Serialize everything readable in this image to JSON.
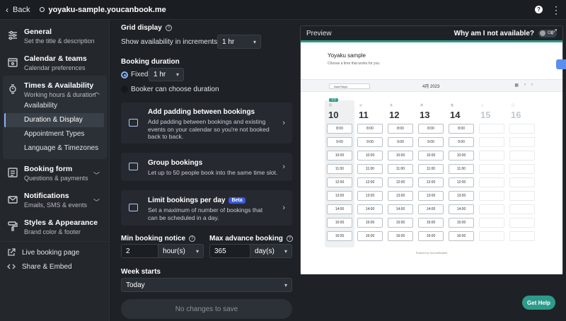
{
  "topbar": {
    "back_label": "Back",
    "url": "yoyaku-sample.youcanbook.me"
  },
  "sidebar": {
    "items": [
      {
        "title": "General",
        "subtitle": "Set the title & description"
      },
      {
        "title": "Calendar & teams",
        "subtitle": "Calendar preferences"
      },
      {
        "title": "Times & Availability",
        "subtitle": "Working hours & duration"
      },
      {
        "title": "Booking form",
        "subtitle": "Questions & payments"
      },
      {
        "title": "Notifications",
        "subtitle": "Emails, SMS & events"
      },
      {
        "title": "Styles & Appearance",
        "subtitle": "Brand color & footer"
      }
    ],
    "subitems": [
      "Availability",
      "Duration & Display",
      "Appointment Types",
      "Language & Timezones"
    ],
    "links": [
      "Live booking page",
      "Share & Embed"
    ]
  },
  "main": {
    "grid_display_label": "Grid display",
    "increments_text": "Show availability in increments of",
    "increments_value": "1 hr",
    "booking_duration_label": "Booking duration",
    "fixed_label": "Fixed",
    "fixed_value": "1 hr",
    "booker_choose_label": "Booker can choose duration",
    "cards": [
      {
        "title": "Add padding between bookings",
        "desc": "Add padding between bookings and existing events on your calendar so you're not booked back to back."
      },
      {
        "title": "Group bookings",
        "desc": "Let up to 50 people book into the same time slot."
      },
      {
        "title": "Limit bookings per day",
        "badge": "Beta",
        "desc": "Set a maximum of number of bookings that can be scheduled in a day."
      }
    ],
    "min_notice_label": "Min booking notice",
    "min_notice_value": "2",
    "min_notice_unit": "hour(s)",
    "max_advance_label": "Max advance booking",
    "max_advance_value": "365",
    "max_advance_unit": "day(s)",
    "week_starts_label": "Week starts",
    "week_starts_value": "Today",
    "save_label": "No changes to save"
  },
  "preview": {
    "title": "Preview",
    "why_label": "Why am I not available?",
    "toggle_label": "Off",
    "booking": {
      "title": "Yoyaku sample",
      "subtitle": "Choose a time that works for you.",
      "timezone": "Asia/Tokyo",
      "month": "4月 2023",
      "today_badge": "今日",
      "days": [
        {
          "weekday": "月",
          "date": "10",
          "available": true
        },
        {
          "weekday": "火",
          "date": "11",
          "available": true
        },
        {
          "weekday": "水",
          "date": "12",
          "available": true
        },
        {
          "weekday": "木",
          "date": "13",
          "available": true
        },
        {
          "weekday": "金",
          "date": "14",
          "available": true
        },
        {
          "weekday": "土",
          "date": "15",
          "available": false
        },
        {
          "weekday": "日",
          "date": "16",
          "available": false
        }
      ],
      "times": [
        "8:00",
        "9:00",
        "10:00",
        "11:00",
        "12:00",
        "13:00",
        "14:00",
        "15:00",
        "16:00"
      ],
      "footer": "Powered by YouCanBookMe"
    }
  },
  "get_help_label": "Get Help"
}
